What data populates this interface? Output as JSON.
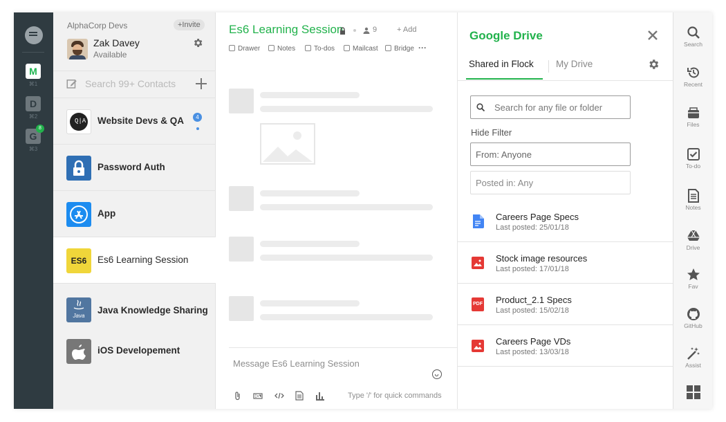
{
  "teams": [
    {
      "letter": "M",
      "shortcut": "⌘1",
      "active": true
    },
    {
      "letter": "D",
      "shortcut": "⌘2",
      "active": false
    },
    {
      "letter": "G",
      "shortcut": "⌘3",
      "active": false,
      "badge": "8"
    }
  ],
  "workspace": {
    "name": "AlphaCorp Devs",
    "invite_label": "+Invite"
  },
  "user": {
    "name": "Zak Davey",
    "status": "Available"
  },
  "contact_search": {
    "placeholder": "Search 99+ Contacts"
  },
  "contacts": [
    {
      "label": "Website Devs & QA",
      "badge": "4",
      "icon": "qa-logo"
    },
    {
      "label": "Password Auth",
      "icon": "lock-icon"
    },
    {
      "label": "App",
      "icon": "app-store-icon"
    },
    {
      "label": "Es6 Learning Session",
      "icon": "es6-logo",
      "icon_text": "ES6",
      "active": true
    },
    {
      "label": "Java Knowledge Sharing",
      "icon": "java-logo",
      "icon_text": "Java"
    },
    {
      "label": "iOS Developement",
      "icon": "apple-icon"
    }
  ],
  "chat": {
    "title": "Es6 Learning Session",
    "member_count": "9",
    "add_label": "+ Add",
    "toolbar": [
      "Drawer",
      "Notes",
      "To-dos",
      "Mailcast",
      "Bridge"
    ],
    "more": "···",
    "message_placeholder": "Message Es6 Learning Session",
    "hint": "Type '/' for quick commands"
  },
  "drive": {
    "title": "Google Drive",
    "tabs": [
      "Shared in Flock",
      "My Drive"
    ],
    "search_placeholder": "Search for any file or folder",
    "hide_filter": "Hide Filter",
    "from_value": "From: Anyone",
    "posted_value": "Posted in: Any",
    "files": [
      {
        "name": "Careers Page Specs",
        "date": "Last posted: 25/01/18",
        "type": "doc",
        "color": "#4285f4"
      },
      {
        "name": "Stock image resources",
        "date": "Last posted: 17/01/18",
        "type": "image",
        "color": "#e53935"
      },
      {
        "name": "Product_2.1 Specs",
        "date": "Last posted: 15/02/18",
        "type": "pdf",
        "type_label": "PDF",
        "color": "#e53935"
      },
      {
        "name": "Careers Page VDs",
        "date": "Last posted: 13/03/18",
        "type": "image",
        "color": "#e53935"
      }
    ]
  },
  "tools": [
    {
      "label": "Search",
      "icon": "search-icon"
    },
    {
      "label": "Recent",
      "icon": "history-icon"
    },
    {
      "label": "Files",
      "icon": "files-icon"
    },
    {
      "label": "To-do",
      "icon": "todo-icon"
    },
    {
      "label": "Notes",
      "icon": "notes-icon"
    },
    {
      "label": "Drive",
      "icon": "drive-icon"
    },
    {
      "label": "Fav",
      "icon": "star-icon"
    },
    {
      "label": "GitHub",
      "icon": "github-icon"
    },
    {
      "label": "Assist",
      "icon": "magic-wand-icon"
    },
    {
      "label": "",
      "icon": "apps-grid-icon"
    }
  ],
  "colors": {
    "accent": "#22b24c",
    "rail": "#2f3b41",
    "badge": "#4a90e2"
  }
}
